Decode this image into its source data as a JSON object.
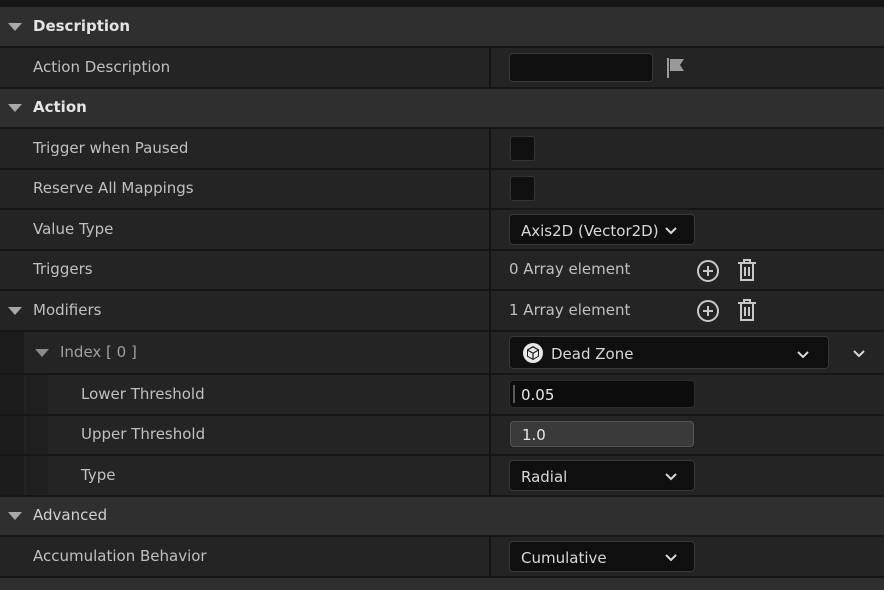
{
  "sections": {
    "description": {
      "title": "Description",
      "action_description_label": "Action Description",
      "action_description_value": ""
    },
    "action": {
      "title": "Action",
      "trigger_when_paused_label": "Trigger when Paused",
      "trigger_when_paused_checked": false,
      "reserve_all_mappings_label": "Reserve All Mappings",
      "reserve_all_mappings_checked": false,
      "value_type_label": "Value Type",
      "value_type_value": "Axis2D (Vector2D)",
      "triggers_label": "Triggers",
      "triggers_value": "0 Array element",
      "modifiers_label": "Modifiers",
      "modifiers_value": "1 Array element",
      "index_label": "Index [ 0 ]",
      "index_value": "Dead Zone",
      "lower_threshold_label": "Lower Threshold",
      "lower_threshold_value": "0.05",
      "lower_threshold_fill": 0.05,
      "upper_threshold_label": "Upper Threshold",
      "upper_threshold_value": "1.0",
      "upper_threshold_fill": 1.0,
      "type_label": "Type",
      "type_value": "Radial"
    },
    "advanced": {
      "title": "Advanced",
      "accumulation_behavior_label": "Accumulation Behavior",
      "accumulation_behavior_value": "Cumulative"
    }
  },
  "icons": {
    "flag": "flag-icon",
    "add": "plus-circle-icon",
    "delete": "trash-icon",
    "cube": "cube-icon",
    "chevron": "chevron-down-icon"
  },
  "colors": {
    "category_bg": "#2f2f2f",
    "row_bg": "#242424",
    "field_bg": "#0f0f0f",
    "separator": "#151515",
    "text": "#c0c0c0"
  }
}
